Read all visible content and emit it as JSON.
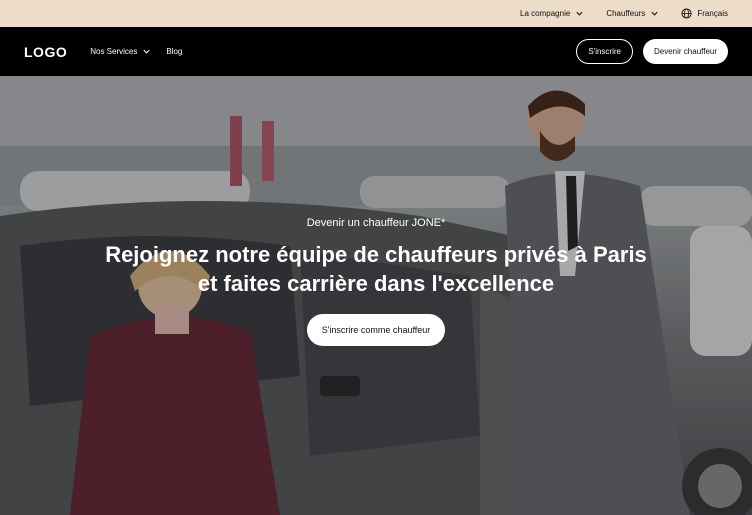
{
  "topbar": {
    "items": [
      {
        "label": "La compagnie",
        "icon": "chevron-down-icon"
      },
      {
        "label": "Chauffeurs",
        "icon": "chevron-down-icon"
      },
      {
        "label": "Français",
        "icon": "globe-icon"
      }
    ]
  },
  "navbar": {
    "logo": "LOGO",
    "links": [
      {
        "label": "Nos Services",
        "icon": "chevron-down-icon"
      },
      {
        "label": "Blog"
      }
    ],
    "signup_label": "S'inscrire",
    "become_driver_label": "Devenir chauffeur"
  },
  "hero": {
    "eyebrow": "Devenir un chauffeur JONE*",
    "headline": "Rejoignez notre équipe de chauffeurs privés à Paris et faites carrière dans l'excellence",
    "cta_label": "S'inscrire comme chauffeur"
  },
  "colors": {
    "topbar_bg": "#ecdcc8",
    "navbar_bg": "#000000",
    "button_white": "#ffffff"
  }
}
